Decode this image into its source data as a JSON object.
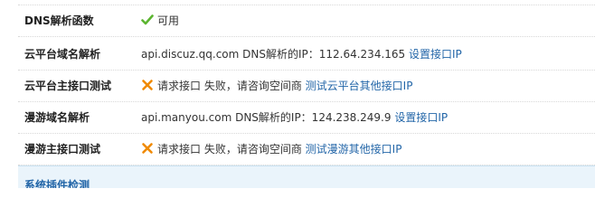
{
  "rows": [
    {
      "label": "DNS解析函数",
      "status": "ok",
      "text": "可用"
    },
    {
      "label": "云平台域名解析",
      "text": "api.discuz.qq.com DNS解析的IP：112.64.234.165",
      "link": "设置接口IP"
    },
    {
      "label": "云平台主接口测试",
      "status": "fail",
      "text": "请求接口 失败，请咨询空间商",
      "link": "测试云平台其他接口IP"
    },
    {
      "label": "漫游域名解析",
      "text": "api.manyou.com DNS解析的IP：124.238.249.9",
      "link": "设置接口IP"
    },
    {
      "label": "漫游主接口测试",
      "status": "fail",
      "text": "请求接口 失败，请咨询空间商",
      "link": "测试漫游其他接口IP"
    }
  ],
  "section": {
    "title": "系统插件检测"
  },
  "colors": {
    "link": "#2366a8",
    "ok": "#5cb531",
    "fail": "#f08a00",
    "section_bg": "#eaf4fb"
  },
  "icons": {
    "ok": "check-icon",
    "fail": "cross-icon"
  }
}
